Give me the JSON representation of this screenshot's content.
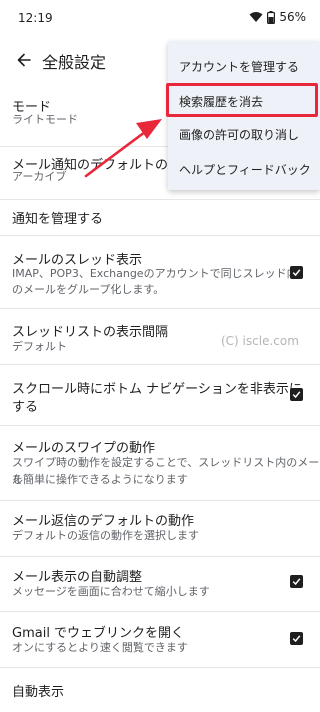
{
  "status_bar": {
    "time": "12:19",
    "battery": "56%"
  },
  "app_bar": {
    "title": "全般設定"
  },
  "settings": [
    {
      "title": "モード",
      "subtitle": "ライトモード"
    },
    {
      "title": "メール通知のデフォルトの動作",
      "subtitle": "アーカイブ"
    },
    {
      "title": "通知を管理する"
    },
    {
      "title": "メールのスレッド表示",
      "subtitle_lines": [
        "IMAP、POP3、Exchangeのアカウントで同じスレッド内",
        "のメールをグループ化します。"
      ],
      "checked": true
    },
    {
      "title": "スレッドリストの表示間隔",
      "subtitle": "デフォルト"
    },
    {
      "title_lines": [
        "スクロール時にボトム ナビゲーションを非表示に",
        "する"
      ],
      "checked": true
    },
    {
      "title": "メールのスワイプの動作",
      "subtitle_lines": [
        "スワイプ時の動作を設定することで、スレッドリスト内のメール",
        "を簡単に操作できるようになります"
      ]
    },
    {
      "title": "メール返信のデフォルトの動作",
      "subtitle": "デフォルトの返信の動作を選択します"
    },
    {
      "title": "メール表示の自動調整",
      "subtitle": "メッセージを画面に合わせて縮小します",
      "checked": true
    },
    {
      "title": "Gmail でウェブリンクを開く",
      "subtitle": "オンにするとより速く閲覧できます",
      "checked": true
    },
    {
      "title": "自動表示"
    }
  ],
  "watermark": "(C) iscle.com",
  "overflow_menu": {
    "items": [
      "アカウントを管理する",
      "検索履歴を消去",
      "画像の許可の取り消し",
      "ヘルプとフィードバック"
    ],
    "highlighted_index": 1
  },
  "annotation": {
    "color": "#e8273a"
  },
  "colors": {
    "checkbox": "#1f1f1f",
    "menu_bg": "#eef2f8"
  }
}
